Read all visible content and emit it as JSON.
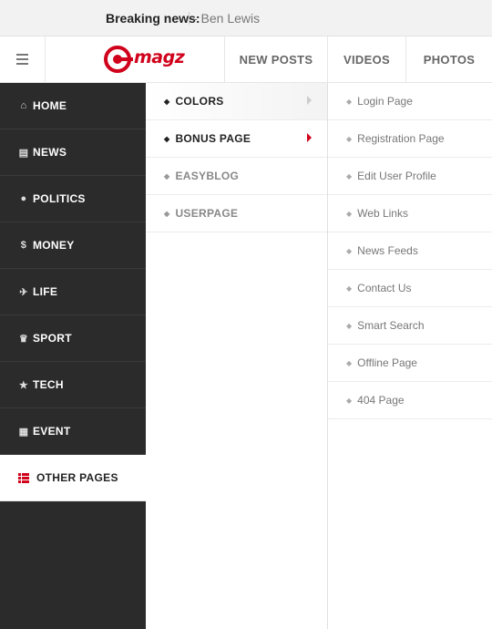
{
  "breaking": {
    "label": "Breaking news:",
    "text": "- Ben Lewis"
  },
  "header": {
    "logo_text": "magz",
    "nav": [
      {
        "label": "NEW POSTS"
      },
      {
        "label": "VIDEOS"
      },
      {
        "label": "PHOTOS"
      }
    ]
  },
  "sidebar": {
    "items": [
      {
        "label": "HOME",
        "icon": "home-icon",
        "glyph": "⌂"
      },
      {
        "label": "NEWS",
        "icon": "file-icon",
        "glyph": "▤"
      },
      {
        "label": "POLITICS",
        "icon": "globe-icon",
        "glyph": "●"
      },
      {
        "label": "MONEY",
        "icon": "dollar-icon",
        "glyph": "$"
      },
      {
        "label": "LIFE",
        "icon": "plane-icon",
        "glyph": "✈"
      },
      {
        "label": "SPORT",
        "icon": "trophy-icon",
        "glyph": "♛"
      },
      {
        "label": "TECH",
        "icon": "star-icon",
        "glyph": "★"
      },
      {
        "label": "EVENT",
        "icon": "calendar-icon",
        "glyph": "▦"
      },
      {
        "label": "OTHER PAGES",
        "icon": "list-icon",
        "glyph": "☰"
      }
    ]
  },
  "submenu": {
    "items": [
      {
        "label": "COLORS"
      },
      {
        "label": "BONUS PAGE"
      },
      {
        "label": "EASYBLOG"
      },
      {
        "label": "USERPAGE"
      }
    ]
  },
  "rightmenu": {
    "items": [
      {
        "label": "Login Page"
      },
      {
        "label": "Registration Page"
      },
      {
        "label": "Edit User Profile"
      },
      {
        "label": "Web Links"
      },
      {
        "label": "News Feeds"
      },
      {
        "label": "Contact Us"
      },
      {
        "label": "Smart Search"
      },
      {
        "label": "Offline Page"
      },
      {
        "label": "404 Page"
      }
    ]
  },
  "colors": {
    "accent": "#d0021b",
    "sidebar_bg": "#2b2b2b"
  }
}
